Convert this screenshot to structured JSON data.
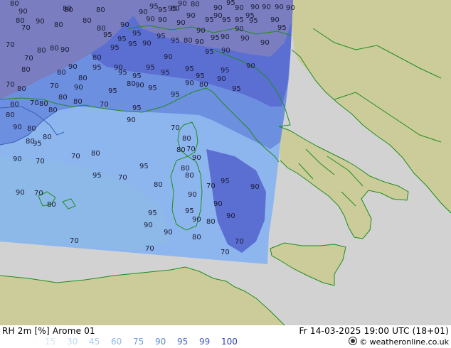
{
  "footer": {
    "title": "RH 2m [%] Arome 01",
    "datetime": "Fr 14-03-2025 19:00 UTC (18+01)",
    "copyright": "© weatheronline.co.uk",
    "legend": [
      {
        "label": "15",
        "color": "#d4e6f7"
      },
      {
        "label": "30",
        "color": "#c2dcf3"
      },
      {
        "label": "45",
        "color": "#a9cbee"
      },
      {
        "label": "60",
        "color": "#8db9e8"
      },
      {
        "label": "75",
        "color": "#6f9fe0"
      },
      {
        "label": "90",
        "color": "#5a86d8"
      },
      {
        "label": "95",
        "color": "#4a6ccc"
      },
      {
        "label": "99",
        "color": "#3d56c0"
      },
      {
        "label": "100",
        "color": "#2d3fae"
      }
    ]
  },
  "map": {
    "colors": {
      "sea_outside": "#d2d2d2",
      "land_outside": "#cccc9a",
      "border_lines": "#1e8c1e",
      "rh_base": "#8db6ef",
      "rh_high": "#6d8fe0",
      "rh_very_high": "#5b6fd3",
      "rh_max": "#7a7ec0"
    },
    "contour_labels": [
      {
        "text": "80"
      },
      {
        "text": "80"
      },
      {
        "text": "80"
      },
      {
        "text": "90"
      },
      {
        "text": "80"
      },
      {
        "text": "80"
      },
      {
        "text": "90"
      },
      {
        "text": "90"
      },
      {
        "text": "95"
      },
      {
        "text": "90"
      },
      {
        "text": "90"
      },
      {
        "text": "90"
      },
      {
        "text": "90"
      },
      {
        "text": "95"
      },
      {
        "text": "95"
      },
      {
        "text": "90"
      },
      {
        "text": "90"
      },
      {
        "text": "95"
      },
      {
        "text": "95"
      },
      {
        "text": "95"
      },
      {
        "text": "70"
      },
      {
        "text": "80"
      },
      {
        "text": "80"
      },
      {
        "text": "90"
      },
      {
        "text": "95"
      },
      {
        "text": "95"
      },
      {
        "text": "95"
      },
      {
        "text": "90"
      },
      {
        "text": "90"
      },
      {
        "text": "95"
      },
      {
        "text": "95"
      },
      {
        "text": "70"
      },
      {
        "text": "80"
      },
      {
        "text": "80"
      },
      {
        "text": "90"
      },
      {
        "text": "90"
      },
      {
        "text": "80"
      },
      {
        "text": "90"
      },
      {
        "text": "90"
      },
      {
        "text": "95"
      },
      {
        "text": "95"
      },
      {
        "text": "95"
      },
      {
        "text": "95"
      },
      {
        "text": "80"
      },
      {
        "text": "70"
      },
      {
        "text": "80"
      },
      {
        "text": "80"
      },
      {
        "text": "95"
      },
      {
        "text": "95"
      },
      {
        "text": "95"
      },
      {
        "text": "70"
      },
      {
        "text": "80"
      },
      {
        "text": "90"
      },
      {
        "text": "80"
      },
      {
        "text": "95"
      },
      {
        "text": "90"
      },
      {
        "text": "95"
      },
      {
        "text": "95"
      },
      {
        "text": "95"
      },
      {
        "text": "80"
      },
      {
        "text": "90"
      },
      {
        "text": "70"
      },
      {
        "text": "80"
      },
      {
        "text": "90"
      },
      {
        "text": "95"
      },
      {
        "text": "90"
      },
      {
        "text": "95"
      },
      {
        "text": "90"
      },
      {
        "text": "95"
      },
      {
        "text": "90"
      },
      {
        "text": "95"
      },
      {
        "text": "80"
      },
      {
        "text": "80"
      },
      {
        "text": "90"
      },
      {
        "text": "95"
      },
      {
        "text": "90"
      },
      {
        "text": "95"
      },
      {
        "text": "90"
      },
      {
        "text": "95"
      },
      {
        "text": "80"
      },
      {
        "text": "90"
      },
      {
        "text": "70"
      },
      {
        "text": "80"
      },
      {
        "text": "95"
      },
      {
        "text": "80"
      },
      {
        "text": "80"
      },
      {
        "text": "90"
      },
      {
        "text": "90"
      },
      {
        "text": "80"
      },
      {
        "text": "90"
      },
      {
        "text": "90"
      },
      {
        "text": "90"
      },
      {
        "text": "90"
      },
      {
        "text": "95"
      },
      {
        "text": "90"
      },
      {
        "text": "95"
      },
      {
        "text": "80"
      },
      {
        "text": "70"
      },
      {
        "text": "80"
      },
      {
        "text": "80"
      },
      {
        "text": "90"
      },
      {
        "text": "80"
      },
      {
        "text": "95"
      },
      {
        "text": "80"
      },
      {
        "text": "70"
      },
      {
        "text": "70"
      },
      {
        "text": "90"
      },
      {
        "text": "80"
      },
      {
        "text": "95"
      },
      {
        "text": "70"
      },
      {
        "text": "90"
      },
      {
        "text": "70"
      },
      {
        "text": "80"
      },
      {
        "text": "70"
      },
      {
        "text": "80"
      },
      {
        "text": "95"
      },
      {
        "text": "90"
      },
      {
        "text": "80"
      },
      {
        "text": "90"
      },
      {
        "text": "70"
      },
      {
        "text": "90"
      },
      {
        "text": "80"
      },
      {
        "text": "95"
      },
      {
        "text": "90"
      },
      {
        "text": "90"
      },
      {
        "text": "80"
      },
      {
        "text": "90"
      },
      {
        "text": "95"
      },
      {
        "text": "80"
      },
      {
        "text": "95"
      },
      {
        "text": "90"
      },
      {
        "text": "90"
      },
      {
        "text": "80"
      },
      {
        "text": "70"
      },
      {
        "text": "70"
      },
      {
        "text": "70"
      },
      {
        "text": "70"
      },
      {
        "text": "70"
      },
      {
        "text": "80"
      },
      {
        "text": "90"
      },
      {
        "text": "90"
      },
      {
        "text": "90"
      },
      {
        "text": "80"
      },
      {
        "text": "90"
      },
      {
        "text": "95"
      },
      {
        "text": "90"
      },
      {
        "text": "80"
      },
      {
        "text": "70"
      },
      {
        "text": "95"
      },
      {
        "text": "80"
      }
    ]
  }
}
